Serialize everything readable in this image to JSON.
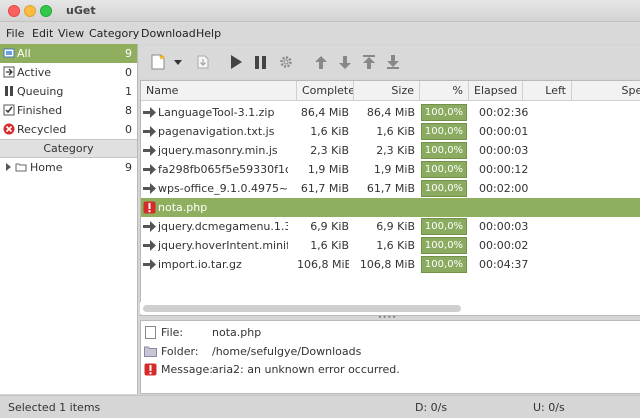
{
  "window": {
    "title": "uGet"
  },
  "menu": [
    "File",
    "Edit",
    "View",
    "Category",
    "Download",
    "Help"
  ],
  "states": [
    {
      "label": "All",
      "count": "9",
      "icon": "all-icon"
    },
    {
      "label": "Active",
      "count": "0",
      "icon": "active-icon"
    },
    {
      "label": "Queuing",
      "count": "1",
      "icon": "queuing-icon"
    },
    {
      "label": "Finished",
      "count": "8",
      "icon": "finished-icon"
    },
    {
      "label": "Recycled",
      "count": "0",
      "icon": "recycled-icon"
    }
  ],
  "category": {
    "header": "Category",
    "home_label": "Home",
    "home_count": "9"
  },
  "toolbar": {
    "icons": [
      "new-download-icon",
      "dropdown-arrow-icon",
      "open-file-icon",
      "start-icon",
      "pause-icon",
      "properties-icon",
      "move-up-icon",
      "move-down-icon",
      "move-top-icon",
      "move-bottom-icon"
    ]
  },
  "table": {
    "columns": [
      "Name",
      "Complete",
      "Size",
      "%",
      "Elapsed",
      "Left",
      "Speed"
    ],
    "rows": [
      {
        "name": "LanguageTool-3.1.zip",
        "complete": "86,4 MiB",
        "size": "86,4 MiB",
        "percent": "100,0%",
        "elapsed": "00:02:36",
        "status": "finished"
      },
      {
        "name": "pagenavigation.txt.js",
        "complete": "1,6 KiB",
        "size": "1,6 KiB",
        "percent": "100,0%",
        "elapsed": "00:00:01",
        "status": "finished"
      },
      {
        "name": "jquery.masonry.min.js",
        "complete": "2,3 KiB",
        "size": "2,3 KiB",
        "percent": "100,0%",
        "elapsed": "00:00:03",
        "status": "finished"
      },
      {
        "name": "fa298fb065f5e59330f1c311",
        "complete": "1,9 MiB",
        "size": "1,9 MiB",
        "percent": "100,0%",
        "elapsed": "00:00:12",
        "status": "finished"
      },
      {
        "name": "wps-office_9.1.0.4975~a19p",
        "complete": "61,7 MiB",
        "size": "61,7 MiB",
        "percent": "100,0%",
        "elapsed": "00:02:00",
        "status": "finished"
      },
      {
        "name": "nota.php",
        "complete": "",
        "size": "",
        "percent": "",
        "elapsed": "",
        "status": "error",
        "selected": true
      },
      {
        "name": "jquery.dcmegamenu.1.3.3.js",
        "complete": "6,9 KiB",
        "size": "6,9 KiB",
        "percent": "100,0%",
        "elapsed": "00:00:03",
        "status": "finished"
      },
      {
        "name": "jquery.hoverIntent.minified.j",
        "complete": "1,6 KiB",
        "size": "1,6 KiB",
        "percent": "100,0%",
        "elapsed": "00:00:02",
        "status": "finished"
      },
      {
        "name": "import.io.tar.gz",
        "complete": "106,8 MiB",
        "size": "106,8 MiB",
        "percent": "100,0%",
        "elapsed": "00:04:37",
        "status": "finished"
      }
    ]
  },
  "details": {
    "file_label": "File:",
    "file_value": "nota.php",
    "folder_label": "Folder:",
    "folder_value": "/home/sefulgye/Downloads",
    "message_label": "Message:",
    "message_value": "aria2: an unknown error occurred."
  },
  "status": {
    "selected": "Selected 1 items",
    "download": "D: 0/s",
    "upload": "U: 0/s"
  },
  "colors": {
    "selection": "#8faf5f",
    "progress": "#8aab60",
    "error": "#d62b2b"
  }
}
